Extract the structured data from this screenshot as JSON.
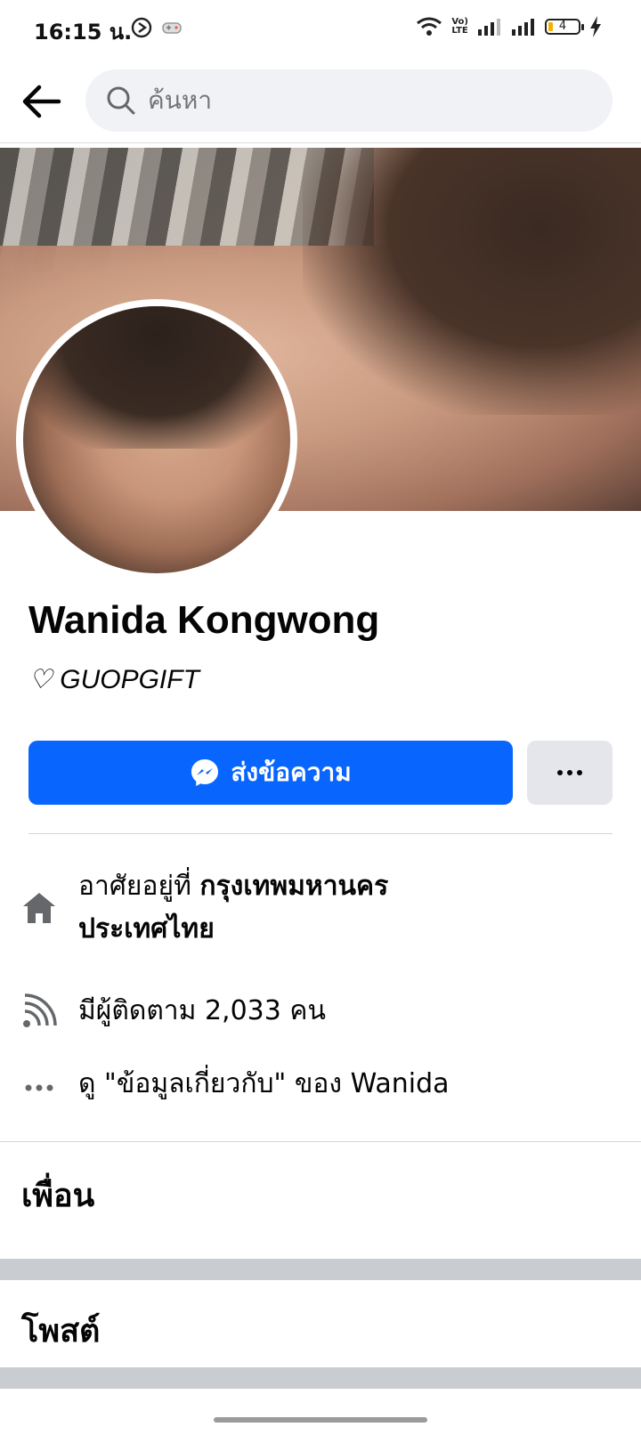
{
  "status_bar": {
    "time": "16:15 น.",
    "lte_top": "Vo)",
    "lte_bottom": "LTE",
    "battery": "4"
  },
  "header": {
    "search_placeholder": "ค้นหา"
  },
  "profile": {
    "name": "Wanida Kongwong",
    "bio": "♡ GUOPGIFT"
  },
  "actions": {
    "message_label": "ส่งข้อความ"
  },
  "info": {
    "lives_prefix": "อาศัยอยู่ที่ ",
    "lives_city": "กรุงเทพมหานคร",
    "lives_country": "ประเทศไทย",
    "followers": "มีผู้ติดตาม 2,033 คน",
    "about": "ดู \"ข้อมูลเกี่ยวกับ\" ของ Wanida"
  },
  "sections": {
    "friends": "เพื่อน",
    "posts": "โพสต์"
  },
  "colors": {
    "primary": "#0866ff",
    "secondary_button": "#e4e6eb",
    "separator": "#c9ccd1"
  }
}
